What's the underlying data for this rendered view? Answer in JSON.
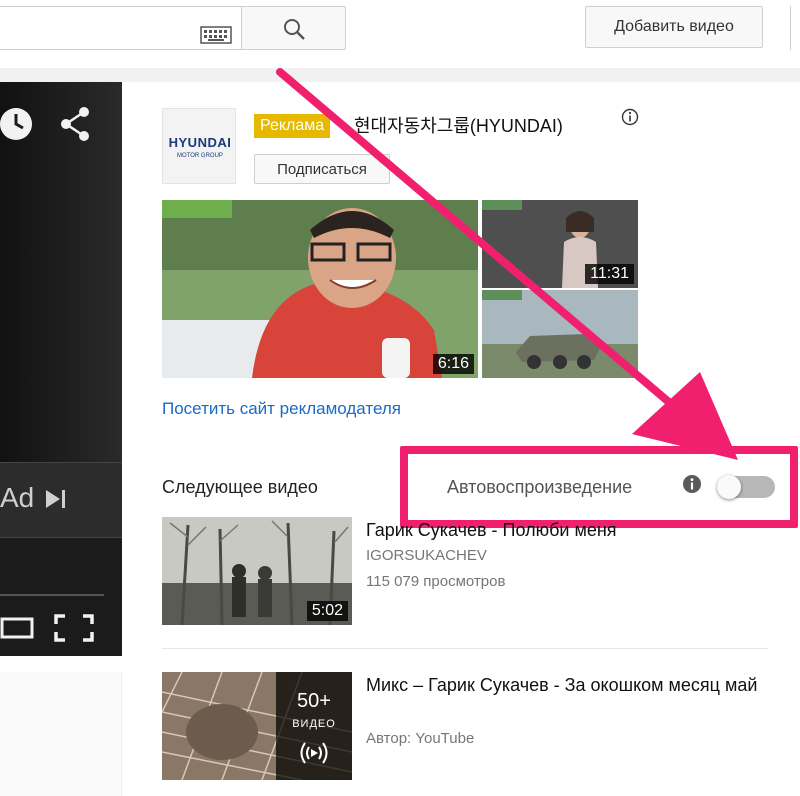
{
  "header": {
    "upload_label": "Добавить видео",
    "icons": [
      "keyboard-icon",
      "search-icon"
    ]
  },
  "player": {
    "ad_label": "Ad",
    "icons": [
      "clock-icon",
      "share-icon",
      "skip-icon",
      "miniplayer-icon",
      "fullscreen-icon"
    ]
  },
  "ad": {
    "logo_text": "HYUNDAI",
    "logo_sub": "MOTOR GROUP",
    "badge": "Реклама",
    "channel": "현대자동차그룹(HYUNDAI)",
    "subscribe_label": "Подписаться",
    "thumbs": [
      {
        "duration": "6:16"
      },
      {
        "duration": "11:31"
      },
      {
        "duration": ""
      }
    ],
    "visit_link": "Посетить сайт рекламодателя"
  },
  "up_next": {
    "title": "Следующее видео",
    "autoplay_label": "Автовоспроизведение",
    "autoplay_on": false,
    "highlight_color": "#f0206e"
  },
  "videos": [
    {
      "title": "Гарик Сукачев - Полюби меня",
      "channel": "IGORSUKACHEV",
      "views": "115 079 просмотров",
      "duration": "5:02"
    },
    {
      "title": "Микс – Гарик Сукачев - За окошком месяц май",
      "channel": "Автор: YouTube",
      "mix_count": "50+",
      "mix_word": "ВИДЕО"
    }
  ]
}
